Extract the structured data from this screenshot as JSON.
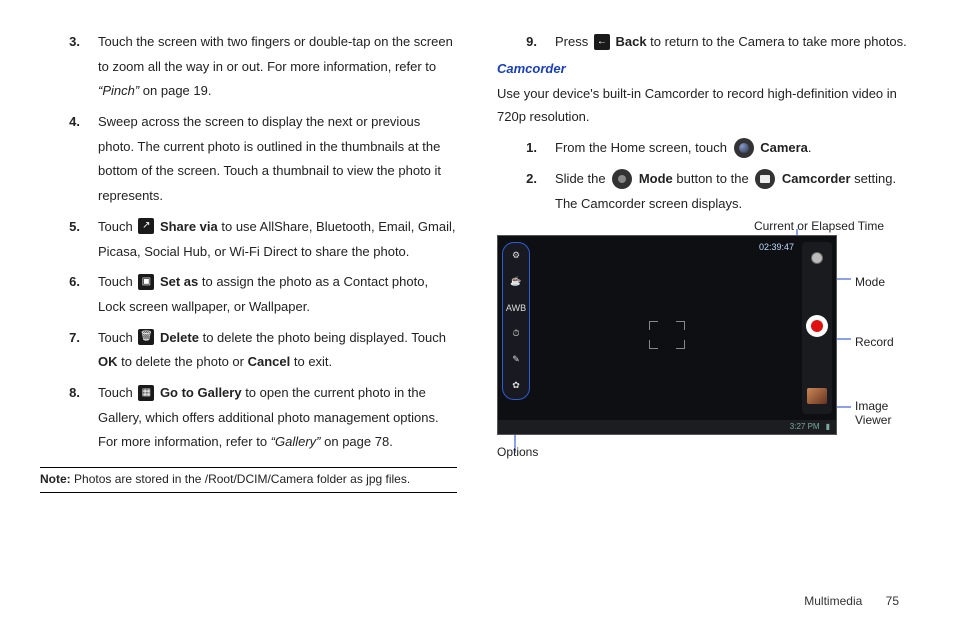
{
  "left": {
    "items": [
      {
        "num": "3.",
        "html": "Touch the screen with two fingers or double-tap on the screen to zoom all the way in or out. For more information, refer to <span class='i'>“Pinch”</span> on page 19."
      },
      {
        "num": "4.",
        "html": "Sweep across the screen to display the next or previous photo. The current photo is outlined in the thumbnails at the bottom of the screen. Touch a thumbnail to view the photo it represents."
      },
      {
        "num": "5.",
        "icon": "share",
        "html": "Touch {ICON} <span class='b'>Share via</span> to use AllShare, Bluetooth, Email, Gmail, Picasa, Social Hub, or Wi-Fi Direct to share the photo."
      },
      {
        "num": "6.",
        "icon": "setas",
        "html": "Touch {ICON} <span class='b'>Set as</span> to assign the photo as a Contact photo, Lock screen wallpaper, or Wallpaper."
      },
      {
        "num": "7.",
        "icon": "delete",
        "html": "Touch {ICON} <span class='b'>Delete</span> to delete the photo being displayed. Touch <span class='b'>OK</span> to delete the photo or <span class='b'>Cancel</span> to exit."
      },
      {
        "num": "8.",
        "icon": "gallery",
        "html": "Touch {ICON} <span class='b'>Go to Gallery</span> to open the current photo in the Gallery, which offers additional photo management options. For more information, refer to <span class='i'>“Gallery”</span> on page 78."
      }
    ],
    "note": "Photos are stored in the /Root/DCIM/Camera folder as jpg files.",
    "note_label": "Note:"
  },
  "right": {
    "item9": {
      "num": "9.",
      "icon": "back",
      "html": "Press {ICON} <span class='b'>Back</span> to return to the Camera to take more photos."
    },
    "heading": "Camcorder",
    "intro": "Use your device's built-in Camcorder to record high-definition video in 720p resolution.",
    "steps": [
      {
        "num": "1.",
        "html": "From the Home screen, touch {CAMICON} <span class='b'>Camera</span>."
      },
      {
        "num": "2.",
        "html": "Slide the {MODEICON} <span class='b'>Mode</span> button to the {CCICON} <span class='b'>Camcorder</span> setting. The Camcorder screen displays."
      }
    ],
    "labels": {
      "elapsed": "Current or Elapsed Time",
      "mode": "Mode",
      "record": "Record",
      "image_viewer_l1": "Image",
      "image_viewer_l2": "Viewer",
      "options": "Options"
    },
    "shot": {
      "timer": "02:39:47",
      "clock": "3:27 PM",
      "sidebar_icons": [
        "⚙",
        "☕",
        "AWB",
        "⏱",
        "✎",
        "✿"
      ]
    }
  },
  "footer": {
    "section": "Multimedia",
    "page": "75"
  },
  "icon_glyphs": {
    "share": "↗",
    "setas": "▣",
    "delete": "🗑",
    "gallery": "▦",
    "back": "←"
  }
}
